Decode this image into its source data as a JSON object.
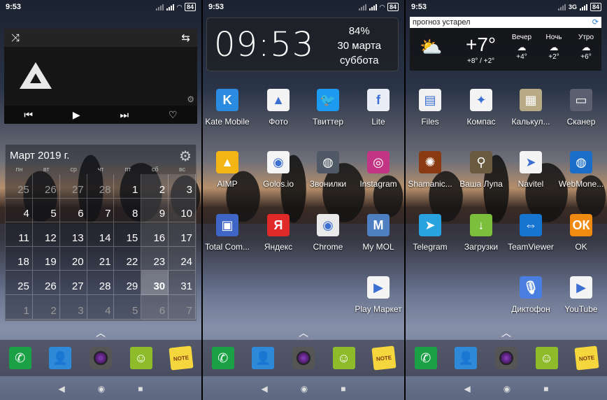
{
  "status": {
    "time": "9:53",
    "battery": "84",
    "network": "3G"
  },
  "music": {
    "shuffle_icon": "shuffle-icon",
    "repeat_icon": "repeat-icon"
  },
  "calendar": {
    "title": "Март 2019 г.",
    "weekdays": [
      "пн",
      "вт",
      "ср",
      "чт",
      "пт",
      "сб",
      "вс"
    ],
    "weeks": [
      [
        "25",
        "26",
        "27",
        "28",
        "1",
        "2",
        "3"
      ],
      [
        "4",
        "5",
        "6",
        "7",
        "8",
        "9",
        "10"
      ],
      [
        "11",
        "12",
        "13",
        "14",
        "15",
        "16",
        "17"
      ],
      [
        "18",
        "19",
        "20",
        "21",
        "22",
        "23",
        "24"
      ],
      [
        "25",
        "26",
        "27",
        "28",
        "29",
        "30",
        "31"
      ],
      [
        "1",
        "2",
        "3",
        "4",
        "5",
        "6",
        "7"
      ]
    ],
    "today": "30"
  },
  "clock": {
    "time": "09:53",
    "battery": "84%",
    "date": "30 марта",
    "weekday": "суббота"
  },
  "weather": {
    "header": "прогноз устарел",
    "temp": "+7°",
    "range": "+8° / +2°",
    "forecast": [
      {
        "label": "Вечер",
        "temp": "+4°"
      },
      {
        "label": "Ночь",
        "temp": "+2°"
      },
      {
        "label": "Утро",
        "temp": "+6°"
      }
    ]
  },
  "screen2_apps": [
    {
      "label": "Kate Mobile",
      "glyph": "K",
      "color": "#2a8be0"
    },
    {
      "label": "Фото",
      "glyph": "▲",
      "color": "#f3f3f3"
    },
    {
      "label": "Твиттер",
      "glyph": "🐦",
      "color": "#1d9bf0"
    },
    {
      "label": "Lite",
      "glyph": "f",
      "color": "#e9eef6"
    },
    {
      "label": "AIMP",
      "glyph": "▲",
      "color": "#f3b514"
    },
    {
      "label": "Golos.io",
      "glyph": "◉",
      "color": "#f5f5f5"
    },
    {
      "label": "Звонилки",
      "glyph": "◍",
      "color": "#505a66"
    },
    {
      "label": "Instagram",
      "glyph": "◎",
      "color": "#c13584"
    },
    {
      "label": "Total Com...",
      "glyph": "▣",
      "color": "#3f66c7"
    },
    {
      "label": "Яндекс",
      "glyph": "Я",
      "color": "#e02a2a"
    },
    {
      "label": "Chrome",
      "glyph": "◉",
      "color": "#e9e9e9"
    },
    {
      "label": "My MOL",
      "glyph": "M",
      "color": "#4e7fc0"
    },
    {
      "label": "Play Маркет",
      "glyph": "▶",
      "color": "#f4f4f4"
    }
  ],
  "screen3_apps": [
    {
      "label": "Files",
      "glyph": "▤",
      "color": "#f1f1f1"
    },
    {
      "label": "Компас",
      "glyph": "✦",
      "color": "#f4f4f4"
    },
    {
      "label": "Калькул...",
      "glyph": "▦",
      "color": "#b9aa86"
    },
    {
      "label": "Сканер",
      "glyph": "▭",
      "color": "#5b6070"
    },
    {
      "label": "Shamanic...",
      "glyph": "✺",
      "color": "#8a3a10"
    },
    {
      "label": "Ваша Лупа",
      "glyph": "⚲",
      "color": "#6a5a40"
    },
    {
      "label": "Navitel",
      "glyph": "➤",
      "color": "#f4f4f4"
    },
    {
      "label": "WebMone...",
      "glyph": "◍",
      "color": "#1a6ec8"
    },
    {
      "label": "Telegram",
      "glyph": "➤",
      "color": "#29a3e0"
    },
    {
      "label": "Загрузки",
      "glyph": "↓",
      "color": "#7cbf3c"
    },
    {
      "label": "TeamViewer",
      "glyph": "⇔",
      "color": "#1575d1"
    },
    {
      "label": "OK",
      "glyph": "ОК",
      "color": "#f08a10"
    },
    {
      "label": "Диктофон",
      "glyph": "🎙",
      "color": "#4a7fe0"
    },
    {
      "label": "YouTube",
      "glyph": "▶",
      "color": "#f4f4f4"
    }
  ],
  "dock": [
    {
      "name": "phone",
      "glyph": "✆"
    },
    {
      "name": "contacts",
      "glyph": "👤"
    },
    {
      "name": "camera",
      "glyph": ""
    },
    {
      "name": "messages",
      "glyph": "☺"
    },
    {
      "name": "notes",
      "glyph": "NOTE"
    }
  ]
}
